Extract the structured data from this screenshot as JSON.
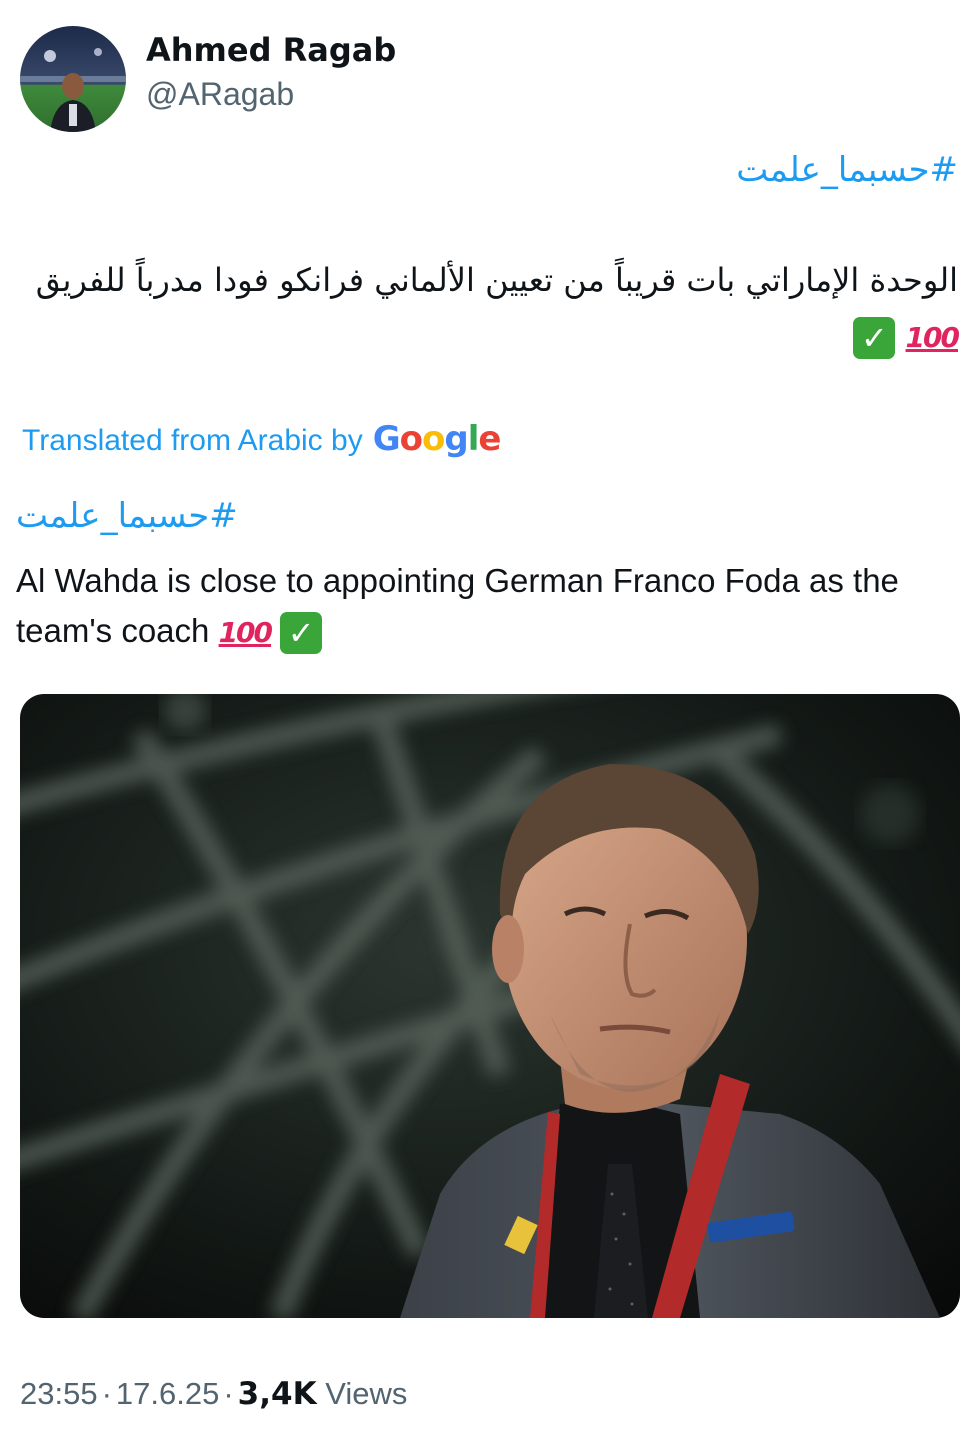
{
  "tweet": {
    "author": {
      "display_name": "Ahmed Ragab",
      "handle": "@ARagab"
    },
    "hashtag_ar": "#حسبما_علمت",
    "body_ar": "الوحدة الإماراتي بات قريباً من تعيين الألماني فرانكو فودا مدرباً للفريق",
    "emoji_hundred": "100",
    "emoji_check": "✓",
    "translated_label": "Translated from Arabic by",
    "translator_brand": {
      "letters": [
        "G",
        "o",
        "o",
        "g",
        "l",
        "e"
      ],
      "colors": [
        "#4285f4",
        "#ea4335",
        "#fbbc05",
        "#4285f4",
        "#34a853",
        "#ea4335"
      ]
    },
    "hashtag_translated": "#حسبما_علمت",
    "body_en": "Al Wahda is close to appointing German Franco Foda as the team's coach",
    "footer": {
      "time": "23:55",
      "separator": "·",
      "date": "17.6.25",
      "views_count": "3,4K",
      "views_label": "Views"
    },
    "colors": {
      "link": "#1d9bf0",
      "text": "#0f1419",
      "muted": "#536471",
      "check_green": "#3aa639",
      "hundred_red": "#e0245e"
    }
  }
}
